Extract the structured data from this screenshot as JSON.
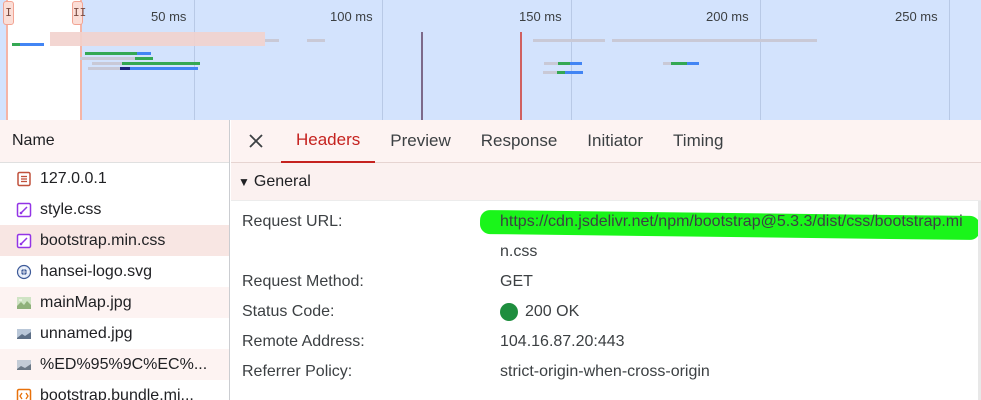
{
  "timeline": {
    "handle_left": "I",
    "handle_right": "II",
    "ticks": [
      "50 ms",
      "100 ms",
      "150 ms",
      "200 ms",
      "250 ms"
    ]
  },
  "name_column": {
    "header": "Name",
    "requests": [
      {
        "name": "127.0.0.1",
        "icon": "document-icon"
      },
      {
        "name": "style.css",
        "icon": "stylesheet-icon"
      },
      {
        "name": "bootstrap.min.css",
        "icon": "stylesheet-icon"
      },
      {
        "name": "hansei-logo.svg",
        "icon": "svg-image-icon"
      },
      {
        "name": "mainMap.jpg",
        "icon": "image-icon"
      },
      {
        "name": "unnamed.jpg",
        "icon": "image-icon"
      },
      {
        "name": "%ED%95%9C%EC%...",
        "icon": "image-icon"
      },
      {
        "name": "bootstrap.bundle.mi...",
        "icon": "script-icon"
      }
    ],
    "selected_index": 2
  },
  "details": {
    "close_icon": "close-icon",
    "tabs": [
      "Headers",
      "Preview",
      "Response",
      "Initiator",
      "Timing"
    ],
    "active_tab": "Headers",
    "section_title": "General",
    "general": {
      "request_url_label": "Request URL:",
      "request_url": "https://cdn.jsdelivr.net/npm/bootstrap@5.3.3/dist/css/bootstrap.min.css",
      "request_method_label": "Request Method:",
      "request_method": "GET",
      "status_code_label": "Status Code:",
      "status_code": "200 OK",
      "status_color": "#1e8e3e",
      "remote_address_label": "Remote Address:",
      "remote_address": "104.16.87.20:443",
      "referrer_policy_label": "Referrer Policy:",
      "referrer_policy": "strict-origin-when-cross-origin"
    }
  },
  "colors": {
    "accent": "#c5221f",
    "timeline_bg": "#d3e3fd",
    "highlight": "#1af51a"
  }
}
